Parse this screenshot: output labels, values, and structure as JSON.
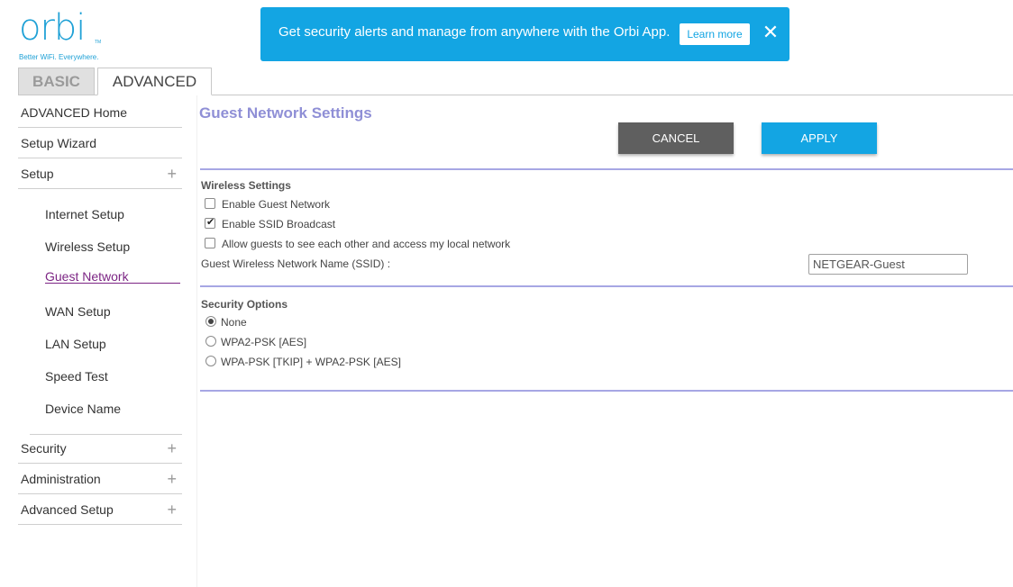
{
  "logo": {
    "word": "orbi",
    "tm": "TM",
    "tagline": "Better WiFi. Everywhere."
  },
  "banner": {
    "text": "Get security alerts and manage from anywhere with the Orbi App.",
    "learn_more": "Learn more",
    "close": "✕"
  },
  "tabs": {
    "basic": "BASIC",
    "advanced": "ADVANCED",
    "active": "ADVANCED"
  },
  "sidebar": {
    "items": [
      "ADVANCED Home",
      "Setup Wizard",
      "Setup"
    ],
    "setup_subitems": [
      "Internet Setup",
      "Wireless Setup",
      "Guest Network",
      "WAN Setup",
      "LAN Setup",
      "Speed Test",
      "Device Name"
    ],
    "lower_items": [
      "Security",
      "Administration",
      "Advanced Setup"
    ],
    "plus": "+",
    "active": "Guest Network"
  },
  "main": {
    "title": "Guest Network Settings",
    "cancel": "CANCEL",
    "apply": "APPLY",
    "wireless": {
      "title": "Wireless Settings",
      "enable_guest": {
        "label": "Enable Guest Network",
        "checked": false
      },
      "ssid_broadcast": {
        "label": "Enable SSID Broadcast",
        "checked": true
      },
      "allow_guests": {
        "label": "Allow guests to see each other and access my local network",
        "checked": false
      },
      "ssid_label": "Guest Wireless Network Name (SSID) :",
      "ssid_value": "NETGEAR-Guest"
    },
    "security": {
      "title": "Security Options",
      "options": [
        "None",
        "WPA2-PSK [AES]",
        "WPA-PSK [TKIP] + WPA2-PSK [AES]"
      ],
      "selected": "None"
    }
  },
  "colors": {
    "brand_blue": "#13a5e3",
    "title_purple": "#8f8fd6",
    "active_purple": "#7c2584",
    "divider": "#a7a7e4",
    "cancel_gray": "#5f5f5f"
  }
}
